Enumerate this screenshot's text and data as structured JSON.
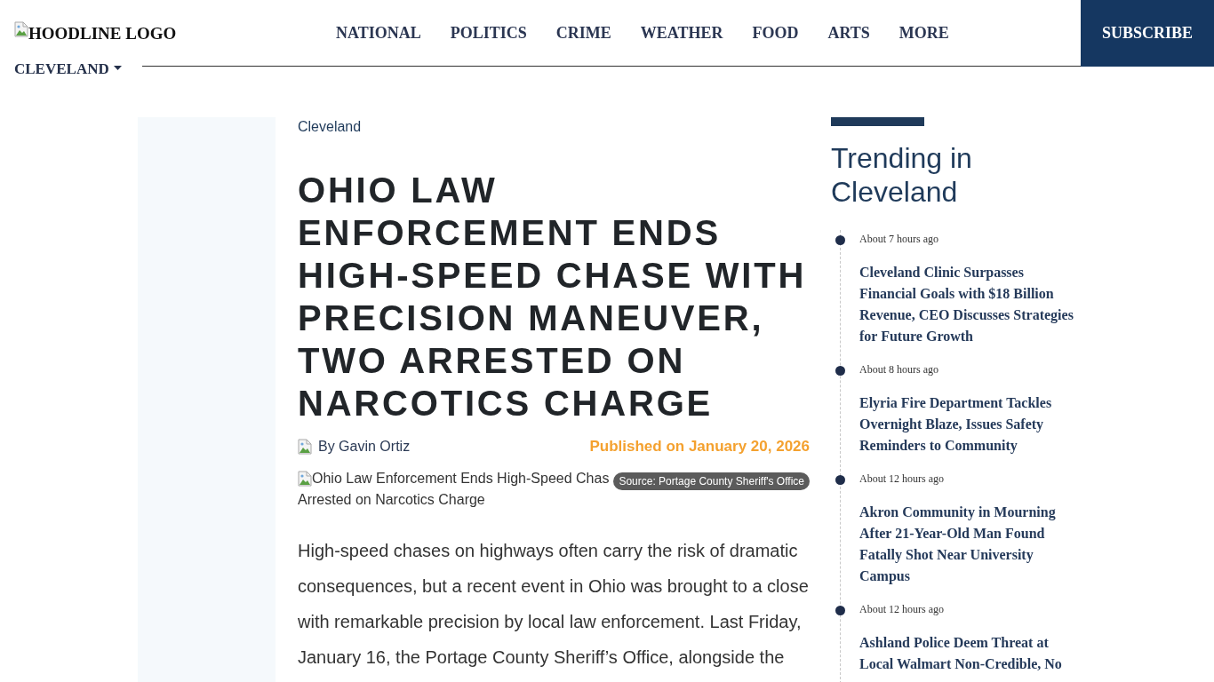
{
  "header": {
    "logo_alt": "HOODLINE LOGO",
    "edition": "CLEVELAND",
    "nav": [
      "NATIONAL",
      "POLITICS",
      "CRIME",
      "WEATHER",
      "FOOD",
      "ARTS",
      "MORE"
    ],
    "subscribe": "SUBSCRIBE"
  },
  "article": {
    "category": "Cleveland",
    "title": "OHIO LAW ENFORCEMENT ENDS HIGH-SPEED CHASE WITH PRECISION MANEUVER, TWO ARRESTED ON NARCOTICS CHARGE",
    "author": "By Gavin Ortiz",
    "published": "Published on January 20, 2026",
    "image": {
      "alt_line_1": "Ohio Law Enforcement Ends High-Speed Chas",
      "alt_line_2": "Arrested on Narcotics Charge",
      "caption": "Source: Portage County Sheriff's Office"
    },
    "body": "High-speed chases on highways often carry the risk of dramatic consequences, but a recent event in Ohio was brought to a close with remarkable precision by local law enforcement. Last Friday, January 16, the Portage County Sheriff’s Office, alongside the"
  },
  "sidebar": {
    "title": "Trending in Cleveland",
    "items": [
      {
        "time": "About 7 hours ago",
        "headline": "Cleveland Clinic Surpasses Financial Goals with $18 Billion Revenue, CEO Discusses Strategies for Future Growth"
      },
      {
        "time": "About 8 hours ago",
        "headline": "Elyria Fire Department Tackles Overnight Blaze, Issues Safety Reminders to Community"
      },
      {
        "time": "About 12 hours ago",
        "headline": "Akron Community in Mourning After 21-Year-Old Man Found Fatally Shot Near University Campus"
      },
      {
        "time": "About 12 hours ago",
        "headline": "Ashland Police Deem Threat at Local Walmart Non-Credible, No"
      }
    ]
  }
}
